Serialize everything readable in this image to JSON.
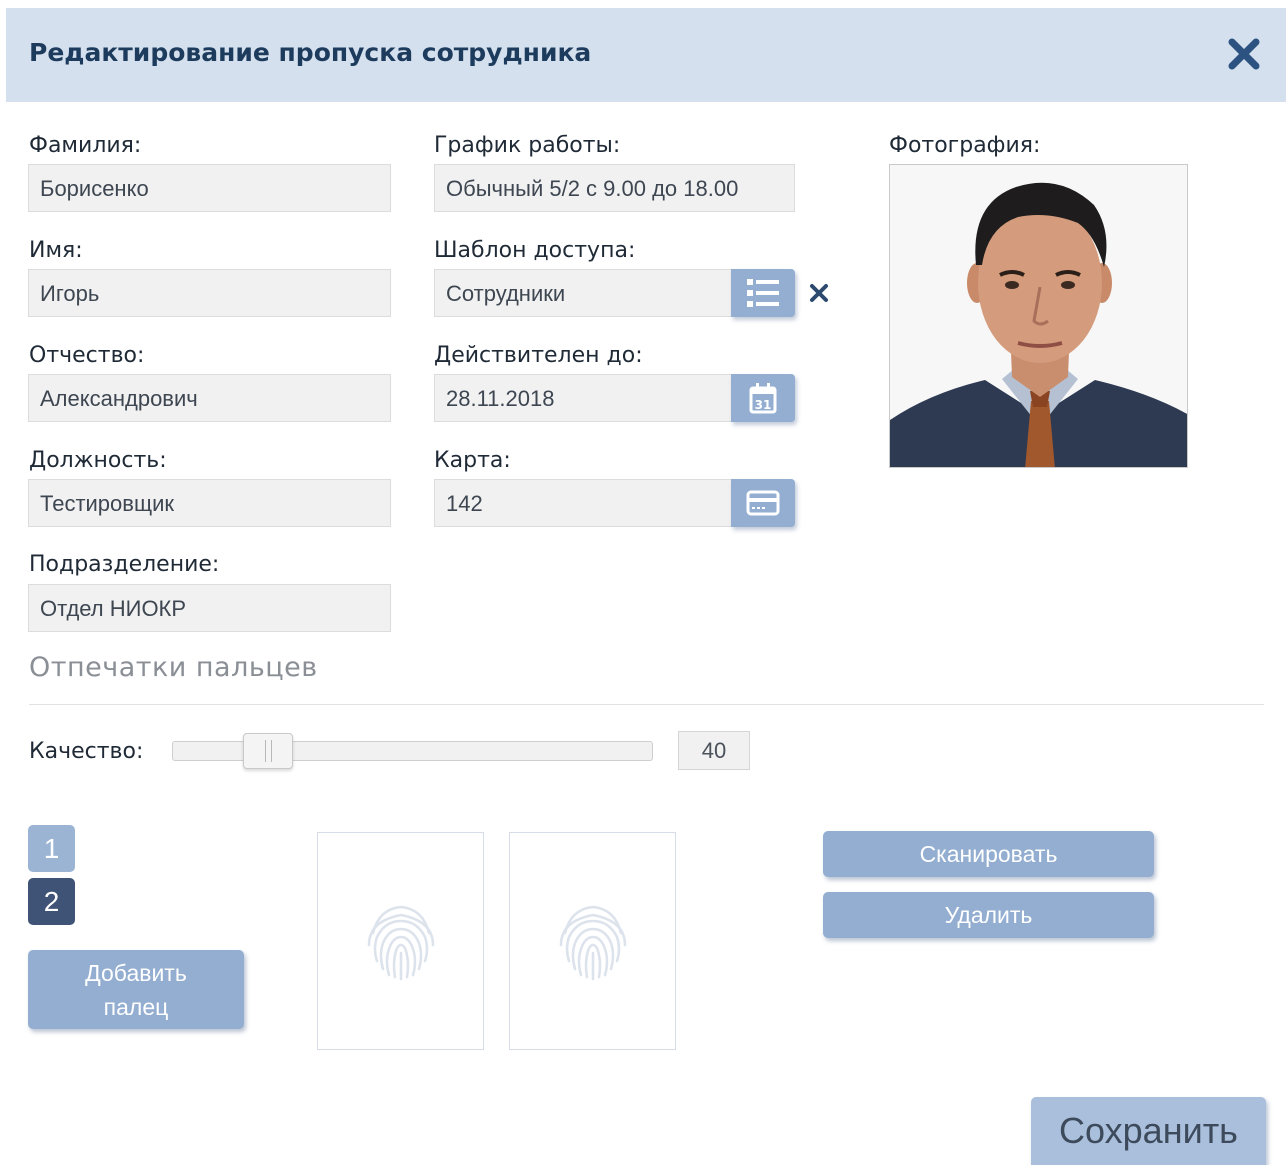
{
  "dialog": {
    "title": "Редактирование пропуска сотрудника",
    "close_icon": "close-icon"
  },
  "fields": {
    "last_name": {
      "label": "Фамилия:",
      "value": "Борисенко"
    },
    "first_name": {
      "label": "Имя:",
      "value": "Игорь"
    },
    "patronymic": {
      "label": "Отчество:",
      "value": "Александрович"
    },
    "position": {
      "label": "Должность:",
      "value": "Тестировщик"
    },
    "department": {
      "label": "Подразделение:",
      "value": "Отдел НИОКР"
    },
    "schedule": {
      "label": "График работы:",
      "value": "Обычный 5/2 с 9.00 до 18.00"
    },
    "access_template": {
      "label": "Шаблон доступа:",
      "value": "Сотрудники",
      "button_icon": "list-icon",
      "clear_icon": "clear-x-icon"
    },
    "valid_until": {
      "label": "Действителен до:",
      "value": "28.11.2018",
      "button_icon": "calendar-icon"
    },
    "card": {
      "label": "Карта:",
      "value": "142",
      "button_icon": "card-icon"
    },
    "photo": {
      "label": "Фотография:"
    }
  },
  "fingerprints": {
    "section_title": "Отпечатки пальцев",
    "quality_label": "Качество:",
    "quality_value": "40",
    "quality_min": 0,
    "quality_max": 200,
    "tabs": [
      {
        "label": "1",
        "active": false
      },
      {
        "label": "2",
        "active": true
      }
    ],
    "add_finger_line1": "Добавить",
    "add_finger_line2": "палец",
    "slot_icon": "fingerprint-icon",
    "scan_label": "Сканировать",
    "delete_label": "Удалить"
  },
  "footer": {
    "save_label": "Сохранить"
  },
  "colors": {
    "header_bg": "#d4e0ee",
    "title": "#1d3b5c",
    "button": "#93aed0",
    "tab_active": "#3f5376",
    "tab_inactive": "#9cb4d3"
  }
}
